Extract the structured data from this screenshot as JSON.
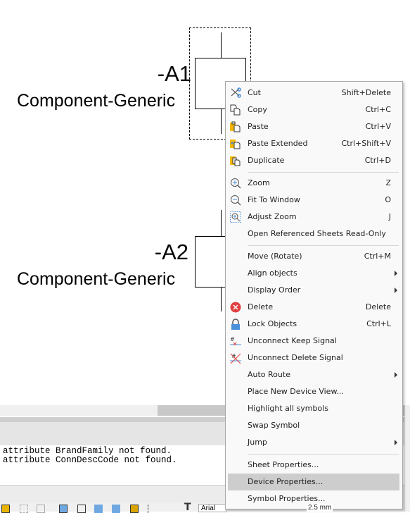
{
  "canvas": {
    "symbols": [
      {
        "id": "-A1",
        "name": "Component-Generic",
        "selected": true
      },
      {
        "id": "-A2",
        "name": "Component-Generic",
        "selected": false
      }
    ]
  },
  "log": {
    "lines": [
      "attribute BrandFamily not found.",
      "attribute ConnDescCode not found."
    ]
  },
  "toolbar": {
    "font_value": "Arial",
    "size_value": "2.5 mm"
  },
  "context_menu": {
    "items": [
      {
        "label": "Cut",
        "shortcut": "Shift+Delete",
        "icon": "scissors-icon"
      },
      {
        "label": "Copy",
        "shortcut": "Ctrl+C",
        "icon": "copy-icon"
      },
      {
        "label": "Paste",
        "shortcut": "Ctrl+V",
        "icon": "paste-icon"
      },
      {
        "label": "Paste Extended",
        "shortcut": "Ctrl+Shift+V",
        "icon": "paste-extended-icon"
      },
      {
        "label": "Duplicate",
        "shortcut": "Ctrl+D",
        "icon": "duplicate-icon"
      },
      {
        "label": "Zoom",
        "shortcut": "Z",
        "icon": "zoom-in-icon"
      },
      {
        "label": "Fit To Window",
        "shortcut": "O",
        "icon": "zoom-out-icon"
      },
      {
        "label": "Adjust Zoom",
        "shortcut": "J",
        "icon": "adjust-zoom-icon"
      },
      {
        "label": "Open Referenced Sheets Read-Only",
        "shortcut": ""
      },
      {
        "label": "Move (Rotate)",
        "shortcut": "Ctrl+M"
      },
      {
        "label": "Align objects",
        "shortcut": "",
        "submenu": true
      },
      {
        "label": "Display Order",
        "shortcut": "",
        "submenu": true
      },
      {
        "label": "Delete",
        "shortcut": "Delete",
        "icon": "delete-icon"
      },
      {
        "label": "Lock Objects",
        "shortcut": "Ctrl+L",
        "icon": "lock-icon"
      },
      {
        "label": "Unconnect Keep Signal",
        "shortcut": "",
        "icon": "unconnect-keep-icon"
      },
      {
        "label": "Unconnect Delete Signal",
        "shortcut": "",
        "icon": "unconnect-delete-icon"
      },
      {
        "label": "Auto Route",
        "shortcut": "",
        "submenu": true
      },
      {
        "label": "Place New Device View...",
        "shortcut": ""
      },
      {
        "label": "Highlight all symbols",
        "shortcut": ""
      },
      {
        "label": "Swap Symbol",
        "shortcut": ""
      },
      {
        "label": "Jump",
        "shortcut": "",
        "submenu": true
      },
      {
        "label": "Sheet Properties...",
        "shortcut": ""
      },
      {
        "label": "Device Properties...",
        "shortcut": "",
        "highlighted": true
      },
      {
        "label": "Symbol Properties...",
        "shortcut": ""
      }
    ]
  },
  "colors": {
    "highlight": "#cdcdcd",
    "icon_blue": "#4a90d9",
    "icon_yellow": "#f5b800",
    "icon_red": "#e04040"
  }
}
